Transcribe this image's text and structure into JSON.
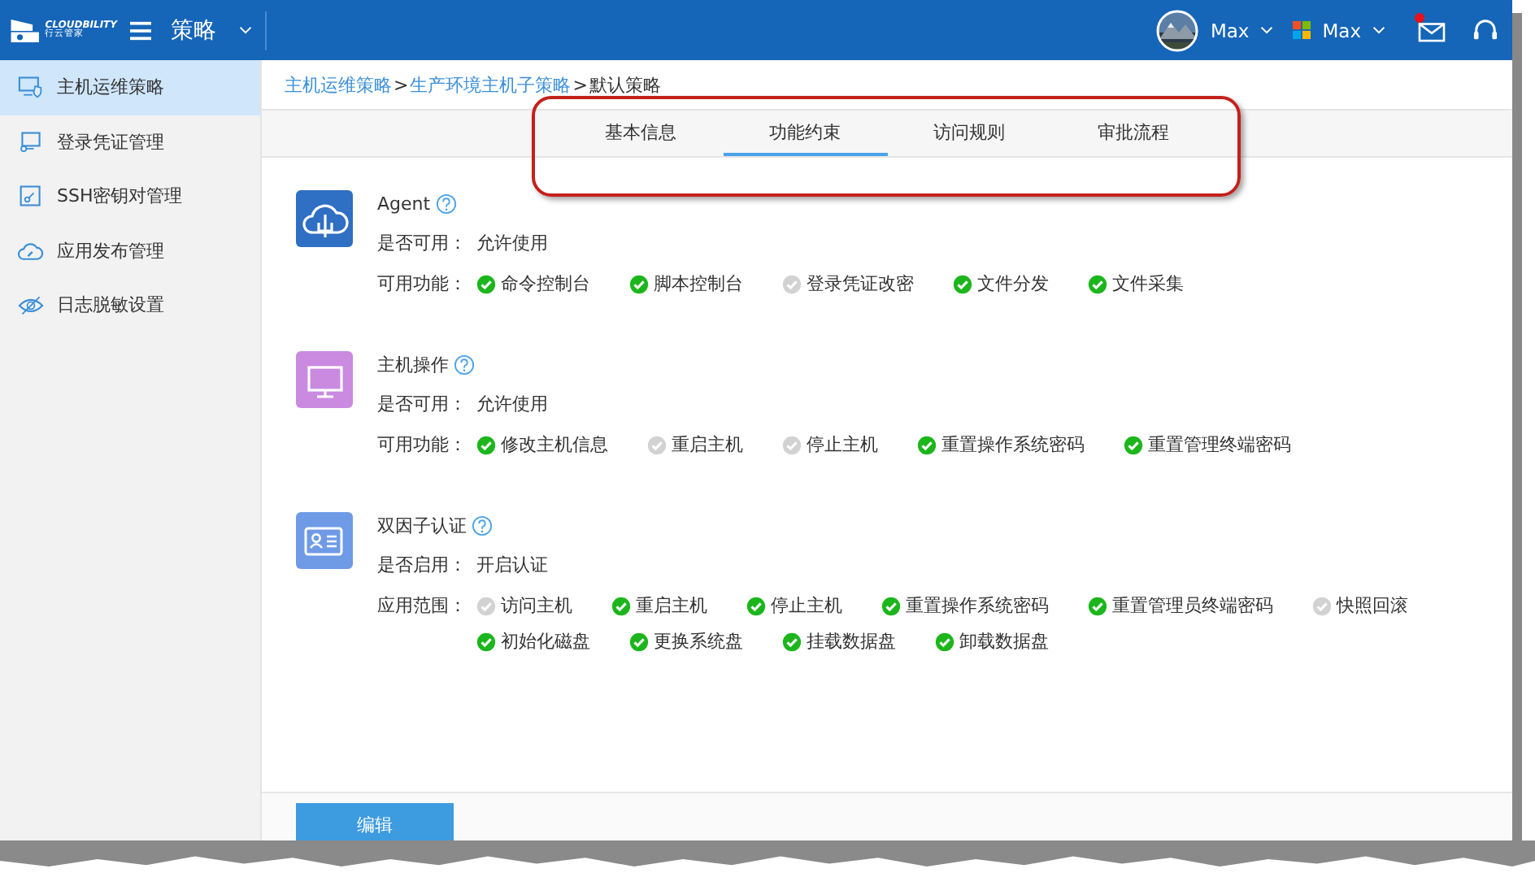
{
  "header": {
    "brand": "CLOUDBILITY",
    "brand_sub": "行云管家",
    "section": "策略",
    "users": [
      {
        "kind": "avatar",
        "name": "Max"
      },
      {
        "kind": "tenant",
        "name": "Max"
      }
    ],
    "mail_unread": true
  },
  "sidebar": {
    "items": [
      {
        "label": "主机运维策略",
        "selected": true
      },
      {
        "label": "登录凭证管理",
        "selected": false
      },
      {
        "label": "SSH密钥对管理",
        "selected": false
      },
      {
        "label": "应用发布管理",
        "selected": false
      },
      {
        "label": "日志脱敏设置",
        "selected": false
      }
    ]
  },
  "breadcrumb": [
    {
      "label": "主机运维策略",
      "link": true
    },
    {
      "label": "生产环境主机子策略",
      "link": true
    },
    {
      "label": "默认策略",
      "link": false
    }
  ],
  "breadcrumb_separator": ">",
  "tabs": [
    {
      "label": "基本信息",
      "selected": false
    },
    {
      "label": "功能约束",
      "selected": true
    },
    {
      "label": "访问规则",
      "selected": false
    },
    {
      "label": "审批流程",
      "selected": false
    }
  ],
  "sections": [
    {
      "title": "Agent",
      "color": "#2f6fc4",
      "status_label": "是否可用：",
      "status": "允许使用",
      "features_label": "可用功能：",
      "features": [
        {
          "label": "命令控制台",
          "enabled": true
        },
        {
          "label": "脚本控制台",
          "enabled": true
        },
        {
          "label": "登录凭证改密",
          "enabled": false
        },
        {
          "label": "文件分发",
          "enabled": true
        },
        {
          "label": "文件采集",
          "enabled": true
        }
      ]
    },
    {
      "title": "主机操作",
      "color": "#c98ae0",
      "status_label": "是否可用：",
      "status": "允许使用",
      "features_label": "可用功能：",
      "features": [
        {
          "label": "修改主机信息",
          "enabled": true
        },
        {
          "label": "重启主机",
          "enabled": false
        },
        {
          "label": "停止主机",
          "enabled": false
        },
        {
          "label": "重置操作系统密码",
          "enabled": true
        },
        {
          "label": "重置管理终端密码",
          "enabled": true
        }
      ]
    },
    {
      "title": "双因子认证",
      "color": "#6f9be6",
      "status_label": "是否启用：",
      "status": "开启认证",
      "features_label": "应用范围：",
      "features": [
        {
          "label": "访问主机",
          "enabled": false
        },
        {
          "label": "重启主机",
          "enabled": true
        },
        {
          "label": "停止主机",
          "enabled": true
        },
        {
          "label": "重置操作系统密码",
          "enabled": true
        },
        {
          "label": "重置管理员终端密码",
          "enabled": true
        },
        {
          "label": "快照回滚",
          "enabled": false
        },
        {
          "label": "初始化磁盘",
          "enabled": true
        },
        {
          "label": "更换系统盘",
          "enabled": true
        },
        {
          "label": "挂载数据盘",
          "enabled": true
        },
        {
          "label": "卸载数据盘",
          "enabled": true
        }
      ]
    }
  ],
  "edit_button": "编辑"
}
